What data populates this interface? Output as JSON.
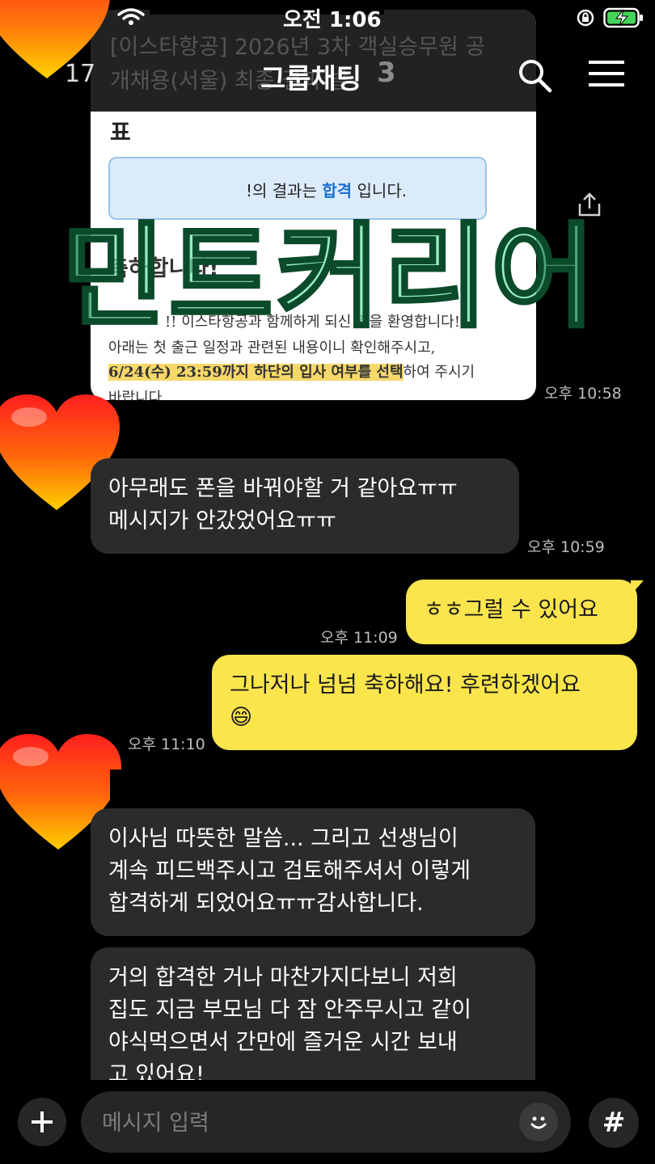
{
  "status_bar": {
    "time": "오전 1:06"
  },
  "header": {
    "back_count": "17",
    "title": "그룹채팅",
    "member_count": "3"
  },
  "shared_image": {
    "title_text": "[이스타항공] 2026년 3차 객실승무원 공개채용(서울) 최종 결과 발",
    "title_end": "표",
    "result_prefix": "!의 결과는 ",
    "result_highlight": "합격",
    "result_suffix": " 입니다.",
    "congrats": "축하합니다!",
    "welcome": "!! 이스타항공과 함께하게 되신 것을 환영합니다!",
    "notice": "아래는 첫 출근 일정과 관련된 내용이니 확인해주시고,",
    "deadline_highlight": "6/24(수) 23:59까지 하단의 입사 여부를 선택",
    "deadline_suffix": "하여 주시기",
    "deadline_end": "바랍니다.",
    "time": "오후 10:58"
  },
  "watermark": "민트커리어",
  "messages": [
    {
      "line1": "아무래도 폰을 바꿔야할 거 같아요ㅠㅠ",
      "line2": "메시지가 안갔었어요ㅠㅠ",
      "time": "오후 10:59"
    },
    {
      "text": "ㅎㅎ그럴 수 있어요",
      "time": "오후 11:09"
    },
    {
      "line1": "그나저나 넘넘 축하해요! 후련하겠어요",
      "emoji": "😄",
      "time": "오후 11:10"
    },
    {
      "line1": "이사님 따뜻한 말씀... 그리고 선생님이",
      "line2": "계속 피드백주시고 검토해주셔서 이렇게",
      "line3": "합격하게 되었어요ㅠㅠ감사합니다."
    },
    {
      "line1": "거의 합격한 거나 마찬가지다보니 저희",
      "line2": "집도 지금 부모님 다 잠 안주무시고 같이",
      "line3": "야식먹으면서 간만에 즐거운 시간 보내",
      "line4": "고 있어요!"
    }
  ],
  "input_bar": {
    "placeholder": "메시지 입력",
    "hash": "#"
  },
  "colors": {
    "my_bubble": "#fbe54d",
    "other_bubble": "#2b2b2b",
    "background": "#000000"
  },
  "icons": [
    "wifi-icon",
    "rotation-lock-icon",
    "battery-charging-icon",
    "search-icon",
    "menu-icon",
    "share-icon",
    "heart-icon",
    "plus-icon",
    "emoji-icon",
    "hash-icon"
  ]
}
